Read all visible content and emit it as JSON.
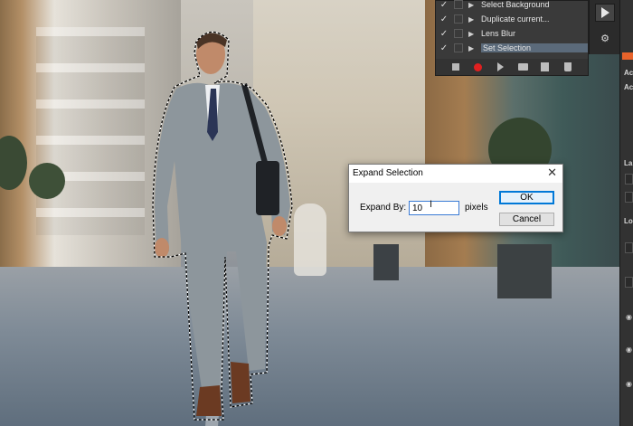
{
  "actions_panel": {
    "items": [
      {
        "label": "Select Background",
        "checked": true,
        "selected": false
      },
      {
        "label": "Duplicate current...",
        "checked": true,
        "selected": false
      },
      {
        "label": "Lens Blur",
        "checked": true,
        "selected": false
      },
      {
        "label": "Set Selection",
        "checked": true,
        "selected": true
      }
    ],
    "toolbar": [
      "stop-icon",
      "record-icon",
      "play-icon",
      "folder-icon",
      "new-action-icon",
      "trash-icon"
    ]
  },
  "dialog": {
    "title": "Expand Selection",
    "close_glyph": "✕",
    "expand_label": "Expand By:",
    "expand_value": "10",
    "unit": "pixels",
    "ok_label": "OK",
    "cancel_label": "Cancel"
  },
  "side_panel": {
    "labels": [
      "Ac",
      "Ac",
      "La",
      "Lo"
    ]
  },
  "colors": {
    "record": "#e02020",
    "accent_orange": "#e8632b",
    "selected_row": "#5b6a7a",
    "dialog_focus": "#0078d7"
  }
}
